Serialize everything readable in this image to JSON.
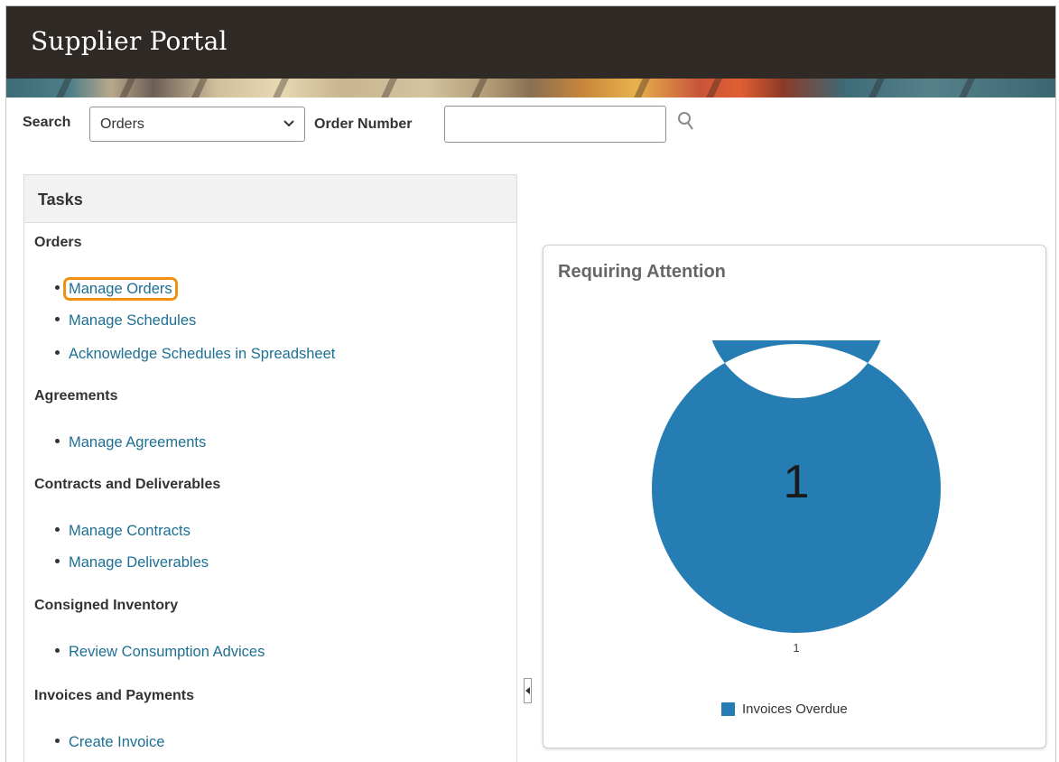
{
  "app": {
    "title": "Supplier Portal"
  },
  "search": {
    "label": "Search",
    "selected": "Orders",
    "order_number_label": "Order Number",
    "order_number_value": ""
  },
  "tasks": {
    "title": "Tasks",
    "sections": [
      {
        "heading": "Orders",
        "items": [
          "Manage Orders",
          "Manage Schedules",
          "Acknowledge Schedules in Spreadsheet"
        ]
      },
      {
        "heading": "Agreements",
        "items": [
          "Manage Agreements"
        ]
      },
      {
        "heading": "Contracts and Deliverables",
        "items": [
          "Manage Contracts",
          "Manage Deliverables"
        ]
      },
      {
        "heading": "Consigned Inventory",
        "items": [
          "Review Consumption Advices"
        ]
      },
      {
        "heading": "Invoices and Payments",
        "items": [
          "Create Invoice"
        ]
      }
    ],
    "highlighted_item": "Manage Orders"
  },
  "attention": {
    "title": "Requiring Attention",
    "total": "1",
    "slice_label": "1"
  },
  "chart_data": {
    "type": "pie",
    "categories": [
      "Invoices Overdue"
    ],
    "values": [
      1
    ],
    "colors": [
      "#267db3"
    ],
    "legend": [
      "Invoices Overdue"
    ],
    "center_label": "1",
    "legend_position": "bottom"
  },
  "colors": {
    "header_bg": "#302a26",
    "link": "#1d6f93",
    "highlight": "#f0920e",
    "donut": "#267db3"
  }
}
